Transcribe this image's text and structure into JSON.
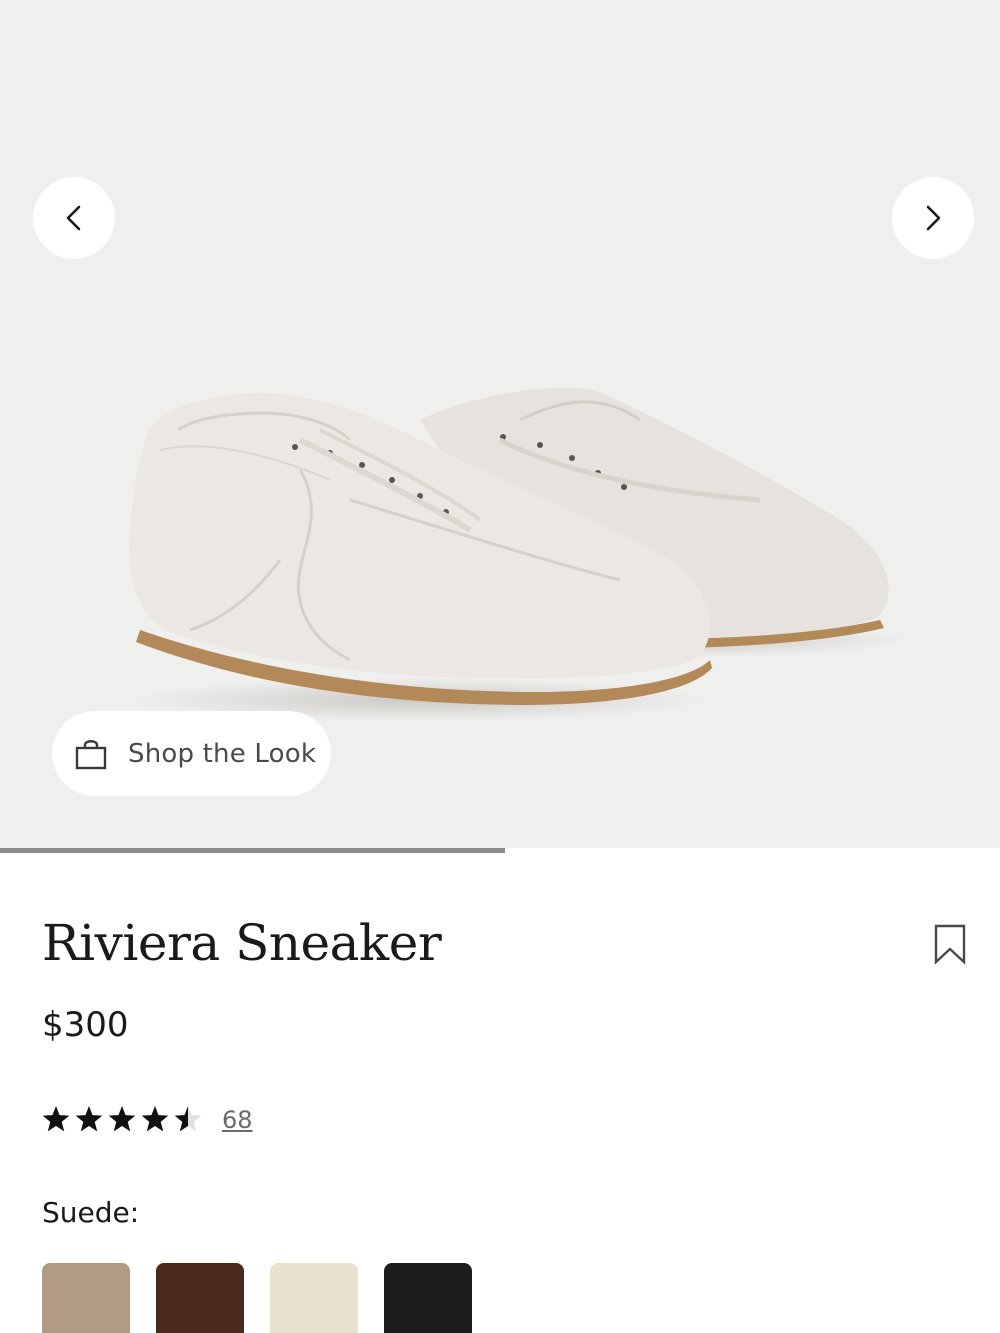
{
  "gallery": {
    "prev_icon": "chevron-left-icon",
    "next_icon": "chevron-right-icon",
    "progress": 0.505,
    "shop_the_look": {
      "icon": "shopping-bag-icon",
      "label": "Shop the Look"
    }
  },
  "product": {
    "name": "Riviera Sneaker",
    "price": "$300",
    "bookmark_icon": "bookmark-icon",
    "rating": {
      "stars": 4.5,
      "max": 5,
      "count": "68"
    },
    "material": {
      "label": "Suede:",
      "swatches": [
        {
          "color": "#b09a83"
        },
        {
          "color": "#4a2a1c"
        },
        {
          "color": "#ebe1d0"
        },
        {
          "color": "#1d1d1d"
        }
      ]
    }
  },
  "colors": {
    "gallery_bg": "#efefee",
    "text": "#1a1a1a",
    "progress": "#8c8c8c"
  }
}
